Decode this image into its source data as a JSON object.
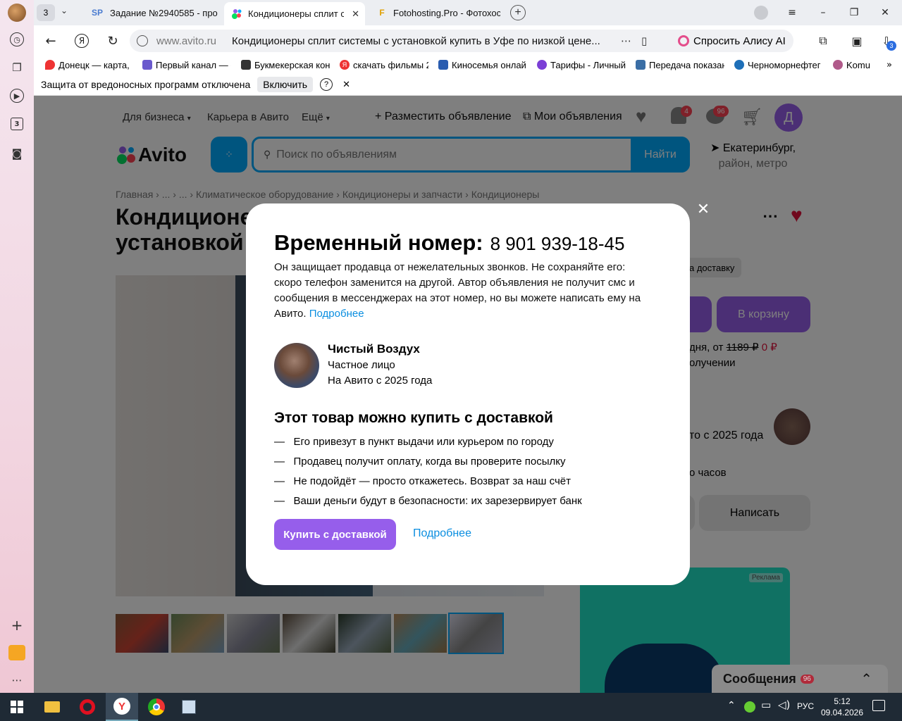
{
  "browser": {
    "tab_count_badge": "3",
    "tabs": [
      {
        "label": "Задание №2940585 - про",
        "favicon": "SP"
      },
      {
        "label": "Кондиционеры сплит с",
        "favicon": "avito"
      },
      {
        "label": "Fotohosting.Pro - Фотохос",
        "favicon": "F"
      }
    ],
    "address": {
      "domain": "www.avito.ru",
      "title": "Кондиционеры сплит системы с установкой купить в Уфе по низкой цене...",
      "alice_label": "Спросить Алису AI"
    },
    "downloads_badge": "3",
    "bookmarks": [
      {
        "label": "Донецк — карта, г",
        "color": "#e33"
      },
      {
        "label": "Первый канал — с",
        "color": "#6a5acd"
      },
      {
        "label": "Букмекерская кон",
        "color": "#333"
      },
      {
        "label": "скачать фильмы 2",
        "color": "#e33"
      },
      {
        "label": "Киносемья онлай",
        "color": "#2a5db0"
      },
      {
        "label": "Тарифы - Личный",
        "color": "#7b3fd6"
      },
      {
        "label": "Передача показан",
        "color": "#3a6ea5"
      },
      {
        "label": "Черноморнефтег",
        "color": "#1e6fb8"
      },
      {
        "label": "Komu",
        "color": "#b05a8a"
      }
    ],
    "infobar": {
      "message": "Защита от вредоносных программ отключена",
      "enable_label": "Включить",
      "help_label": "?"
    }
  },
  "avito": {
    "nav": {
      "business": "Для бизнеса",
      "career": "Карьера в Авито",
      "more": "Ещё",
      "post_ad": "Разместить объявление",
      "my_ads": "Мои объявления",
      "notif_badge": "4",
      "msg_badge": "96",
      "avatar_letter": "Д"
    },
    "logo": "Avito",
    "search": {
      "placeholder": "Поиск по объявлениям",
      "button": "Найти"
    },
    "location": {
      "line1": "Екатеринбург,",
      "line2": "район, метро"
    },
    "breadcrumbs": [
      "Главная",
      "...",
      "...",
      "Климатическое оборудование",
      "Кондиционеры и запчасти",
      "Кондиционеры"
    ],
    "title_line1": "Кондиционе",
    "title_line2": "установкой",
    "right": {
      "delivery_chip": "а доставку",
      "cart_button": "В корзину",
      "delivery_text_prefix": "дня, от",
      "old_price": "1189 ₽",
      "new_price": "0 ₽",
      "on_receipt": "олучении",
      "seller_since": "то с 2025 года",
      "hours": "о часов",
      "write_button": "Написать",
      "ad_label": "Реклама"
    },
    "messages_bar": {
      "label": "Сообщения",
      "badge": "96"
    }
  },
  "modal": {
    "title": "Временный номер:",
    "phone": "8 901 939-18-45",
    "description": "Он защищает продавца от нежелательных звонков. Не сохраняйте его: скоро телефон заменится на другой. Автор объявления не получит смс и сообщения в мессенджерах на этот номер, но вы можете написать ему на Авито.",
    "more_link": "Подробнее",
    "seller": {
      "name": "Чистый Воздух",
      "type": "Частное лицо",
      "since": "На Авито с 2025 года"
    },
    "delivery_title": "Этот товар можно купить с доставкой",
    "bullets": [
      "Его привезут в пункт выдачи или курьером по городу",
      "Продавец получит оплату, когда вы проверите посылку",
      "Не подойдёт — просто откажетесь. Возврат за наш счёт",
      "Ваши деньги будут в безопасности: их зарезервирует банк"
    ],
    "buy_button": "Купить с доставкой",
    "more_link2": "Подробнее"
  },
  "taskbar": {
    "lang": "РУС",
    "time": "5:12",
    "date": "09.04.2026"
  }
}
